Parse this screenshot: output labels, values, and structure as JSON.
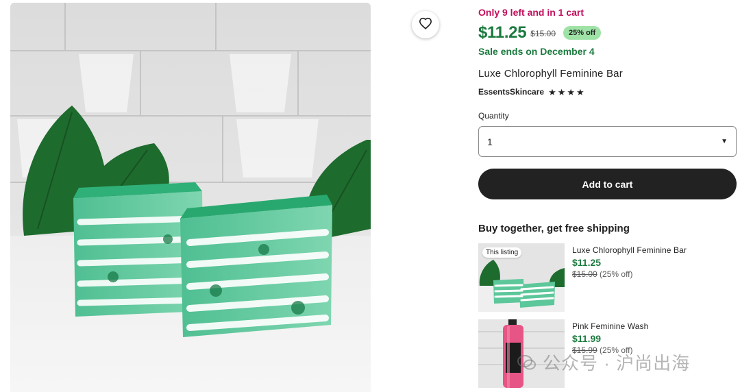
{
  "listing": {
    "stock_notice": "Only 9 left and in 1 cart",
    "price": "$11.25",
    "original_price": "$15.00",
    "discount_badge": "25% off",
    "sale_ends": "Sale ends on December 4",
    "title": "Luxe Chlorophyll Feminine Bar",
    "shop_name": "EssentsSkincare",
    "rating_stars": 4,
    "quantity_label": "Quantity",
    "quantity_value": "1",
    "add_to_cart_label": "Add to cart"
  },
  "bundle": {
    "heading": "Buy together, get free shipping",
    "items": [
      {
        "badge": "This listing",
        "title": "Luxe Chlorophyll Feminine Bar",
        "price": "$11.25",
        "original_price": "$15.00",
        "discount": "(25% off)"
      },
      {
        "title": "Pink Feminine Wash",
        "price": "$11.99",
        "original_price": "$15.99",
        "discount": "(25% off)"
      }
    ]
  },
  "watermark": {
    "text": "公众号 · 沪尚出海"
  },
  "icons": {
    "favorite": "heart-icon",
    "dropdown": "caret-down-icon",
    "rating": "star-icon",
    "watermark": "wechat-icon"
  },
  "colors": {
    "sale_green": "#1b7a3e",
    "stock_red": "#c20e5c",
    "badge_green": "#9fe2a6",
    "cart_button": "#222222"
  }
}
